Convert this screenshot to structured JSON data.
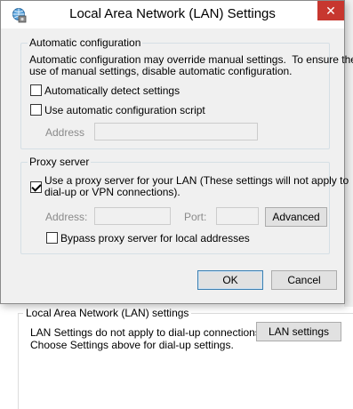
{
  "parent": {
    "lan_group_title": "Local Area Network (LAN) settings",
    "lan_note": "LAN Settings do not apply to dial-up connections.\nChoose Settings above for dial-up settings.",
    "lan_settings_button": "LAN settings"
  },
  "dialog": {
    "title": "Local Area Network (LAN) Settings",
    "close_glyph": "✕",
    "auto_config": {
      "title": "Automatic configuration",
      "description": "Automatic configuration may override manual settings.  To ensure the\nuse of manual settings, disable automatic configuration.",
      "detect_label": "Automatically detect settings",
      "detect_checked": false,
      "script_label": "Use automatic configuration script",
      "script_checked": false,
      "address_label": "Address",
      "address_value": ""
    },
    "proxy": {
      "title": "Proxy server",
      "use_proxy_label": "Use a proxy server for your LAN (These settings will not apply to\ndial-up or VPN connections).",
      "use_proxy_checked": true,
      "address_label": "Address:",
      "address_value": "",
      "port_label": "Port:",
      "port_value": "",
      "advanced_button": "Advanced",
      "bypass_label": "Bypass proxy server for local addresses",
      "bypass_checked": false
    },
    "ok_button": "OK",
    "cancel_button": "Cancel"
  },
  "icons": [
    "network-settings-icon",
    "close-icon",
    "checkbox-checked"
  ],
  "colors": {
    "close_button": "#c7372f",
    "default_button_border": "#3c7fb1",
    "group_border": "#d5dfe5"
  }
}
